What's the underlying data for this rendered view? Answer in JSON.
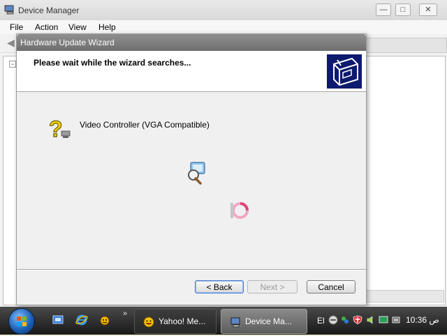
{
  "device_manager": {
    "title": "Device Manager",
    "menu": [
      "File",
      "Action",
      "View",
      "Help"
    ],
    "window_controls": [
      "minimize",
      "maximize",
      "close"
    ]
  },
  "wizard": {
    "title": "Hardware Update Wizard",
    "heading": "Please wait while the wizard searches...",
    "device_name": "Video Controller (VGA Compatible)",
    "buttons": {
      "back": "< Back",
      "next": "Next >",
      "cancel": "Cancel"
    }
  },
  "taskbar": {
    "quick_launch_icons": [
      "show-desktop-icon",
      "internet-explorer-icon",
      "yahoo-messenger-quick-icon"
    ],
    "tasks": [
      {
        "label": "Yahoo! Me...",
        "icon": "yahoo-smiley-icon",
        "active": false
      },
      {
        "label": "Device Ma...",
        "icon": "device-manager-icon",
        "active": true
      }
    ],
    "language": "El",
    "tray_icons": [
      "network-icon",
      "messenger-icon",
      "shield-icon",
      "speaker-icon",
      "monitor-icon",
      "power-icon"
    ],
    "clock": "10:36 ص"
  },
  "colors": {
    "wizard_header_icon_bg": "#0d1a6e",
    "question_icon": "#f2d10e",
    "busy_icon": "#e0457b",
    "taskbar": "#1c1c1c"
  }
}
